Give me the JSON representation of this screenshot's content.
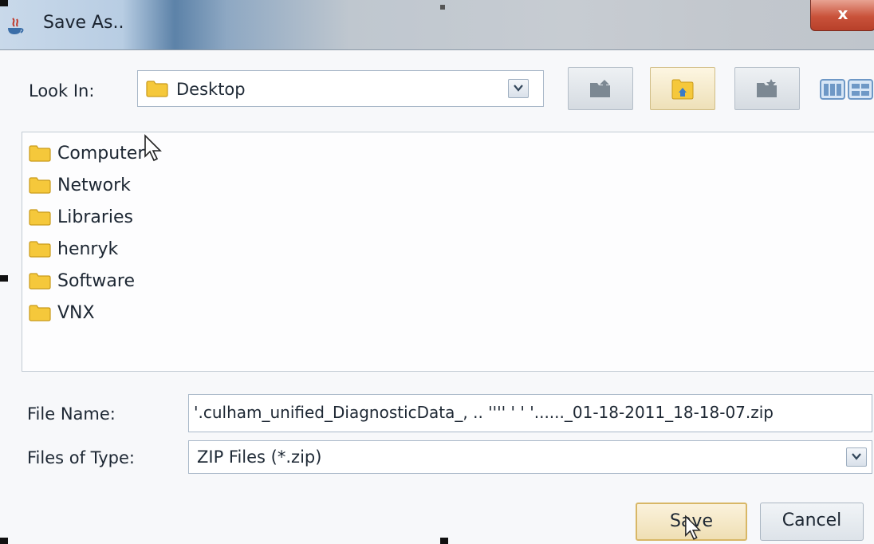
{
  "window": {
    "title": "Save As..",
    "close_label": "x"
  },
  "look_in": {
    "label": "Look In:",
    "value": "Desktop"
  },
  "toolbar": {
    "buttons": [
      {
        "name": "up-one-level"
      },
      {
        "name": "home",
        "active": true
      },
      {
        "name": "create-new-folder"
      }
    ]
  },
  "files": [
    {
      "label": "Computer"
    },
    {
      "label": "Network"
    },
    {
      "label": "Libraries"
    },
    {
      "label": "henryk"
    },
    {
      "label": "Software"
    },
    {
      "label": "VNX"
    }
  ],
  "file_name": {
    "label": "File Name:",
    "value": "'.culham_unified_DiagnosticData_, ..   '''' '  ' '......_01-18-2011_18-18-07.zip"
  },
  "file_type": {
    "label": "Files of Type:",
    "value": "ZIP Files (*.zip)"
  },
  "buttons": {
    "save": "Save",
    "cancel": "Cancel"
  },
  "colors": {
    "folder": "#f5c83b",
    "save_border": "#d8b766",
    "close": "#c9523a"
  }
}
